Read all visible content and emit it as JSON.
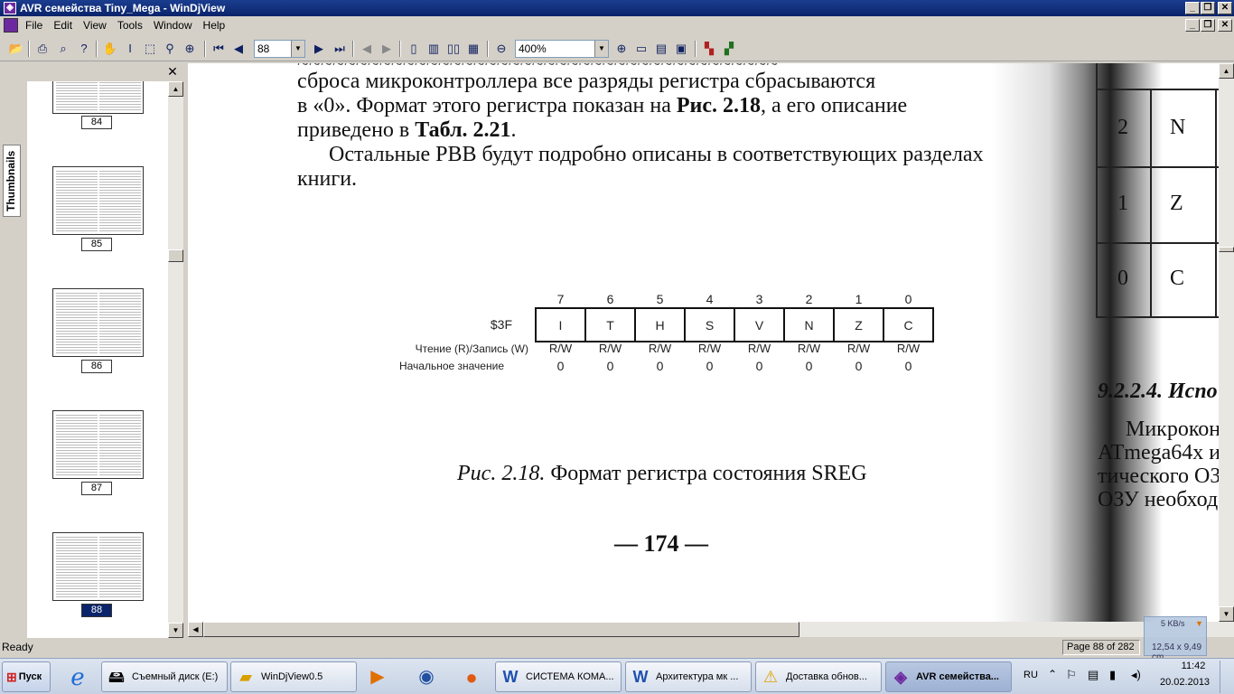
{
  "window": {
    "title": "AVR семейства Tiny_Mega - WinDjView",
    "minimize": "_",
    "restore": "❐",
    "close": "✕"
  },
  "menu": [
    "File",
    "Edit",
    "View",
    "Tools",
    "Window",
    "Help"
  ],
  "toolbar": {
    "page_value": "88",
    "zoom_value": "400%"
  },
  "sidebar": {
    "tab_label": "Thumbnails",
    "close": "✕",
    "thumbnails": [
      {
        "page": "84",
        "selected": false
      },
      {
        "page": "85",
        "selected": false
      },
      {
        "page": "86",
        "selected": false
      },
      {
        "page": "87",
        "selected": false
      },
      {
        "page": "88",
        "selected": true
      }
    ]
  },
  "document": {
    "para_line1": "сброса микроконтроллера все разряды регистра сбрасываются",
    "para_line2a": "в «0». Формат этого регистра показан на ",
    "para_line2b": "Рис. 2.18",
    "para_line2c": ", а его описание",
    "para_line3a": "приведено в ",
    "para_line3b": "Табл. 2.21",
    "para_line3c": ".",
    "para2_line1": "Остальные РВВ будут подробно описаны в соответствующих разделах",
    "para2_line2": "книги.",
    "register": {
      "address": "$3F",
      "rw_label": "Чтение (R)/Запись (W)",
      "init_label": "Начальное значение",
      "bits": [
        {
          "num": "7",
          "name": "I",
          "rw": "R/W",
          "init": "0"
        },
        {
          "num": "6",
          "name": "T",
          "rw": "R/W",
          "init": "0"
        },
        {
          "num": "5",
          "name": "H",
          "rw": "R/W",
          "init": "0"
        },
        {
          "num": "4",
          "name": "S",
          "rw": "R/W",
          "init": "0"
        },
        {
          "num": "3",
          "name": "V",
          "rw": "R/W",
          "init": "0"
        },
        {
          "num": "2",
          "name": "N",
          "rw": "R/W",
          "init": "0"
        },
        {
          "num": "1",
          "name": "Z",
          "rw": "R/W",
          "init": "0"
        },
        {
          "num": "0",
          "name": "C",
          "rw": "R/W",
          "init": "0"
        }
      ]
    },
    "caption_italic": "Рис. 2.18.",
    "caption_text": " Формат регистра состояния SREG",
    "page_number": "— 174 —",
    "right_page": {
      "table_cells": [
        [
          "2",
          "N"
        ],
        [
          "1",
          "Z"
        ],
        [
          "0",
          "C"
        ]
      ],
      "heading": "9.2.2.4. Испо",
      "lines": [
        "Микрокон",
        "ATmega64x и",
        "тического ОЗ",
        "ОЗУ необход"
      ]
    }
  },
  "status": {
    "left": "Ready",
    "page_info": "Page 88 of 282",
    "size_info": "12,54 x 9,49 cm",
    "net_speed": "5 KB/s"
  },
  "taskbar": {
    "start": "Пуск",
    "tasks": [
      {
        "label": "Съемный диск (E:)"
      },
      {
        "label": "WinDjView0.5"
      },
      {
        "label": "СИСТЕМА КОМА..."
      },
      {
        "label": "Архитектура мк ..."
      },
      {
        "label": "Доставка обнов..."
      },
      {
        "label": "AVR семейства..."
      }
    ],
    "lang": "RU",
    "time": "11:42",
    "date": "20.02.2013"
  }
}
